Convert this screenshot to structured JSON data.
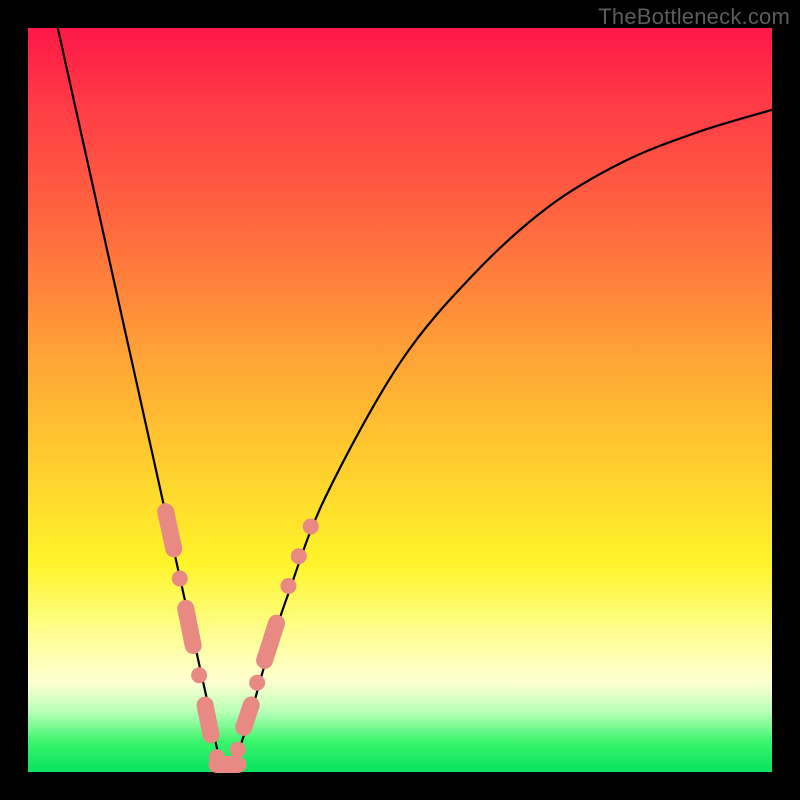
{
  "watermark": "TheBottleneck.com",
  "colors": {
    "bead": "#e88a83",
    "curve": "#000000",
    "frame": "#000000"
  },
  "chart_data": {
    "type": "line",
    "title": "",
    "xlabel": "",
    "ylabel": "",
    "xlim": [
      0,
      100
    ],
    "ylim": [
      0,
      100
    ],
    "grid": false,
    "legend": false,
    "description": "V-shaped bottleneck curve: bottleneck % (y) vs. component balance (x). Minimum ≈0% near x≈26; rises steeply on both sides. Background gradient encodes severity (green=good near bottom, red=bad near top). Salmon beads mark sampled points near the trough.",
    "series": [
      {
        "name": "left-branch",
        "x": [
          4,
          8,
          12,
          16,
          18,
          20,
          22,
          24,
          25,
          26,
          27
        ],
        "y": [
          100,
          82,
          64,
          46,
          37,
          28,
          19,
          10,
          5,
          1,
          0
        ]
      },
      {
        "name": "right-branch",
        "x": [
          27,
          28,
          30,
          32,
          35,
          40,
          50,
          60,
          70,
          80,
          90,
          100
        ],
        "y": [
          0,
          2,
          8,
          15,
          24,
          37,
          55,
          67,
          76,
          82,
          86,
          89
        ]
      }
    ],
    "beads_left": [
      {
        "x": 18.5,
        "y": 35
      },
      {
        "x": 19.6,
        "y": 30
      },
      {
        "x": 20.4,
        "y": 26
      },
      {
        "x": 21.2,
        "y": 22
      },
      {
        "x": 22.2,
        "y": 17
      },
      {
        "x": 23.0,
        "y": 13
      },
      {
        "x": 23.8,
        "y": 9
      },
      {
        "x": 24.6,
        "y": 5
      },
      {
        "x": 25.4,
        "y": 2
      }
    ],
    "beads_right": [
      {
        "x": 28.2,
        "y": 3
      },
      {
        "x": 29.0,
        "y": 6
      },
      {
        "x": 30.0,
        "y": 9
      },
      {
        "x": 30.8,
        "y": 12
      },
      {
        "x": 31.8,
        "y": 15
      },
      {
        "x": 33.4,
        "y": 20
      },
      {
        "x": 35.0,
        "y": 25
      },
      {
        "x": 36.4,
        "y": 29
      },
      {
        "x": 38.0,
        "y": 33
      }
    ],
    "trough_segment": {
      "x0": 25.4,
      "x1": 28.2,
      "y": 1
    }
  }
}
